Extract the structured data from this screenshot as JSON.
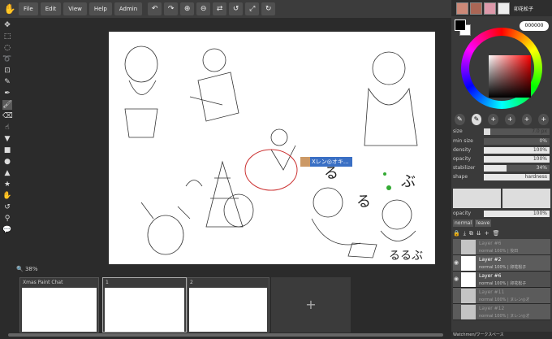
{
  "menu": {
    "file": "File",
    "edit": "Edit",
    "view": "View",
    "help": "Help",
    "admin": "Admin"
  },
  "toolbar_icons": [
    "undo-icon",
    "redo-icon",
    "zoom-in-icon",
    "zoom-out-icon",
    "flip-icon",
    "rotate-icon",
    "fullscreen-icon",
    "reset-icon"
  ],
  "zoom": "38%",
  "floating_user": "Xレン◎オキ...",
  "panels": [
    {
      "title": "Xmas Paint Chat"
    },
    {
      "title": "1"
    },
    {
      "title": "2"
    }
  ],
  "add_panel": "+",
  "users": {
    "current_name": "卯花松子"
  },
  "color": {
    "hex": "000000"
  },
  "brush_props": {
    "size_label": "size",
    "size_value": "7.0 px",
    "size_num": "1.0",
    "size_fraction": 0.1,
    "min_size_label": "min size",
    "min_size_value": "0%",
    "min_size_fraction": 0,
    "density_label": "density",
    "density_value": "100%",
    "density_fraction": 1.0,
    "opacity_label": "opacity",
    "opacity_value": "100%",
    "opacity_fraction": 1.0,
    "stabilizer_label": "stabilizer",
    "stabilizer_value": "34%",
    "stabilizer_fraction": 0.34,
    "shape_label": "shape",
    "shape_value": "hardness"
  },
  "layer_opacity": {
    "label": "opacity",
    "value": "100%",
    "fraction": 1.0
  },
  "blend_mode": "normal",
  "leave_label": "leave",
  "layers": [
    {
      "name": "Layer #6",
      "meta": "normal 100% | 後田",
      "dim": true
    },
    {
      "name": "Layer #2",
      "meta": "normal 100% | 卯花松子",
      "dim": false,
      "selected": true
    },
    {
      "name": "Layer #6",
      "meta": "normal 100% | 卯花松子",
      "dim": false
    },
    {
      "name": "Layer #11",
      "meta": "normal 100% | ヌレン◎オ",
      "dim": true
    },
    {
      "name": "Layer #12",
      "meta": "normal 100% | ヌレン◎オ",
      "dim": true
    }
  ],
  "footer": "Watchmen/ワークスペース"
}
